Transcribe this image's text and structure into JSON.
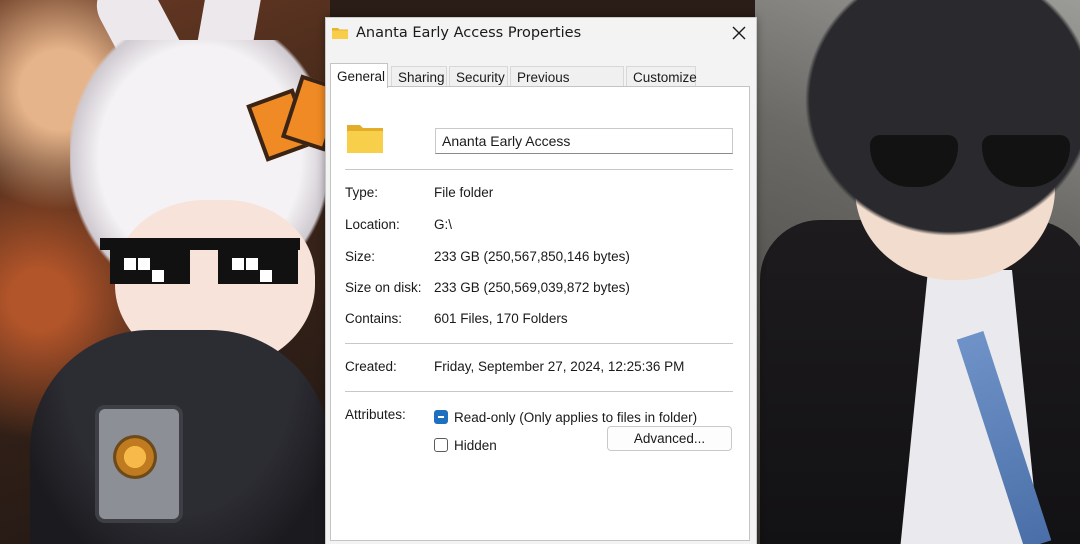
{
  "window": {
    "title": "Ananta Early Access Properties",
    "title_icon": "folder-icon",
    "close_icon": "close-icon"
  },
  "tabs": [
    {
      "label": "General",
      "active": true
    },
    {
      "label": "Sharing",
      "active": false
    },
    {
      "label": "Security",
      "active": false
    },
    {
      "label": "Previous Versions",
      "active": false
    },
    {
      "label": "Customize",
      "active": false
    }
  ],
  "general": {
    "folder_icon": "folder-icon",
    "folder_color": "#f5c542",
    "name_value": "Ananta Early Access",
    "properties": [
      {
        "label": "Type:",
        "value": "File folder"
      },
      {
        "label": "Location:",
        "value": "G:\\"
      },
      {
        "label": "Size:",
        "value": "233 GB (250,567,850,146 bytes)"
      },
      {
        "label": "Size on disk:",
        "value": "233 GB (250,569,039,872 bytes)"
      },
      {
        "label": "Contains:",
        "value": "601 Files, 170 Folders"
      }
    ],
    "created": {
      "label": "Created:",
      "value": "Friday, September 27, 2024, 12:25:36 PM"
    },
    "attributes": {
      "label": "Attributes:",
      "readonly": {
        "label": "Read-only (Only applies to files in folder)",
        "state": "indeterminate"
      },
      "hidden": {
        "label": "Hidden",
        "state": "unchecked"
      },
      "advanced_label": "Advanced..."
    }
  },
  "colors": {
    "accent": "#1f6fbf",
    "dialog_bg": "#f3f3f3",
    "panel_bg": "#ffffff"
  }
}
